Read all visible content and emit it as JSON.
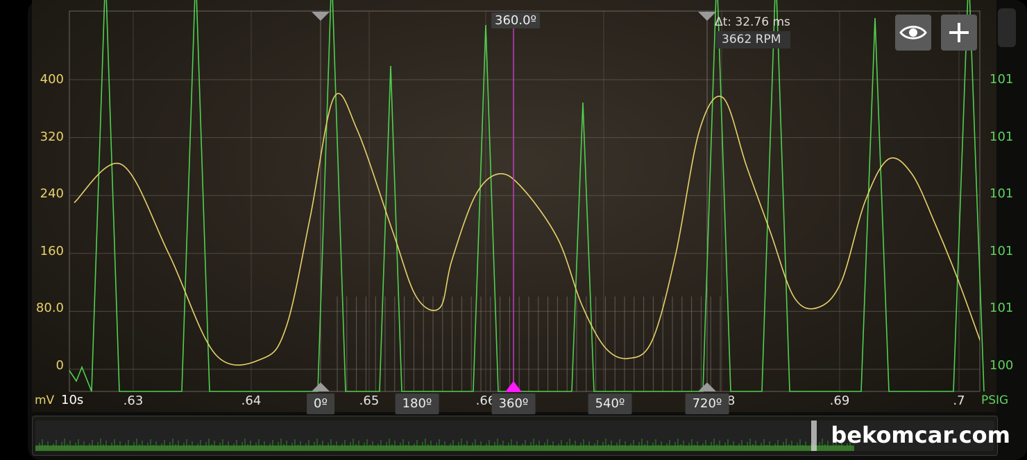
{
  "chart_data": {
    "type": "line",
    "time_window": "10s",
    "x_ticks": [
      ".63",
      ".64",
      ".65",
      ".66",
      ".68",
      ".69",
      ".7"
    ],
    "left_axis": {
      "unit": "mV",
      "ticks": [
        "0",
        "80.0",
        "160",
        "240",
        "320",
        "400"
      ],
      "ylim": [
        0,
        500
      ],
      "color": "#e8d26a"
    },
    "right_axis": {
      "unit": "PSIG",
      "ticks": [
        "100",
        "101",
        "101",
        "101",
        "101",
        "101",
        "101"
      ],
      "color": "#5fd160"
    },
    "cursor": {
      "label": "360.0º",
      "color": "#c23cc2"
    },
    "degree_markers": [
      "0º",
      "180º",
      "360º",
      "540º",
      "720º"
    ],
    "measurement": {
      "delta_t": "Δt: 32.76 ms",
      "rpm": "3662 RPM"
    },
    "series": [
      {
        "color": "#e8d26a",
        "x": [
          0.625,
          0.629,
          0.633,
          0.637,
          0.641,
          0.643,
          0.645,
          0.647,
          0.649,
          0.652,
          0.654,
          0.656,
          0.657,
          0.659,
          0.661,
          0.663,
          0.666,
          0.668,
          0.67,
          0.672,
          0.674,
          0.676,
          0.678,
          0.68,
          0.682,
          0.684,
          0.686,
          0.688,
          0.69,
          0.692,
          0.694,
          0.696,
          0.698,
          0.7,
          0.702
        ],
        "values": [
          230,
          283,
          160,
          20,
          15,
          60,
          210,
          375,
          330,
          190,
          100,
          85,
          150,
          240,
          270,
          250,
          180,
          90,
          30,
          15,
          40,
          160,
          330,
          375,
          280,
          190,
          100,
          85,
          120,
          230,
          290,
          270,
          200,
          120,
          30
        ]
      },
      {
        "color": "#4fd14f",
        "values_description_only_shape": "periodic pressure pulses"
      }
    ]
  },
  "controls": {
    "eye_icon": "eye-icon",
    "add_icon": "plus-icon"
  },
  "watermark": "bekomcar.com"
}
